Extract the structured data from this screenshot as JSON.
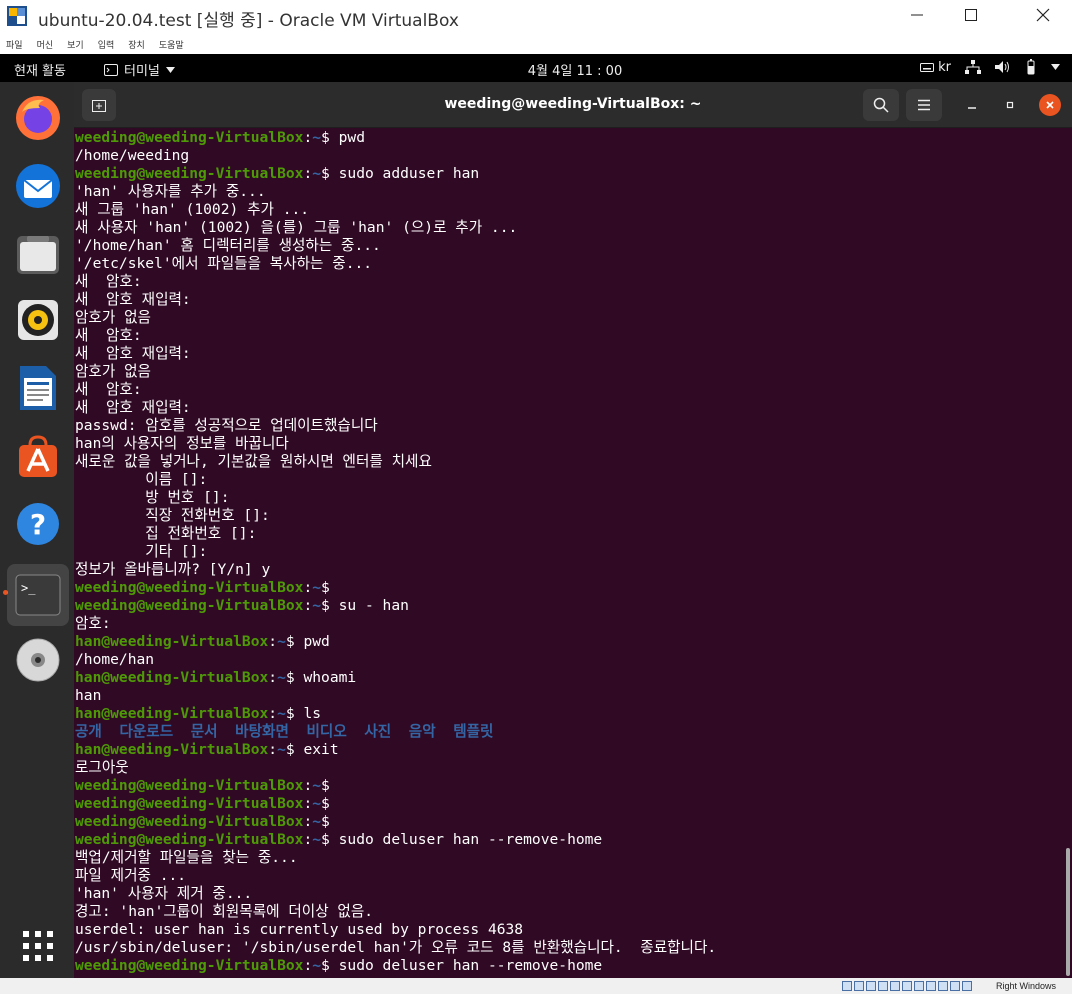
{
  "window": {
    "title": "ubuntu-20.04.test [실행 중] - Oracle VM VirtualBox"
  },
  "vbox_menu": [
    "파일",
    "머신",
    "보기",
    "입력",
    "장치",
    "도움말"
  ],
  "topbar": {
    "activities": "현재 활동",
    "app_name": "터미널",
    "clock": "4월 4일  11 : 00",
    "input_method": "kr"
  },
  "terminal": {
    "title": "weeding@weeding-VirtualBox: ~",
    "lines": [
      {
        "user": "weeding@weeding-VirtualBox",
        "path": "~",
        "cmd": "pwd"
      },
      {
        "text": "/home/weeding"
      },
      {
        "user": "weeding@weeding-VirtualBox",
        "path": "~",
        "cmd": "sudo adduser han"
      },
      {
        "text": "'han' 사용자를 추가 중..."
      },
      {
        "text": "새 그룹 'han' (1002) 추가 ..."
      },
      {
        "text": "새 사용자 'han' (1002) 을(를) 그룹 'han' (으)로 추가 ..."
      },
      {
        "text": "'/home/han' 홈 디렉터리를 생성하는 중..."
      },
      {
        "text": "'/etc/skel'에서 파일들을 복사하는 중..."
      },
      {
        "text": "새  암호:"
      },
      {
        "text": "새  암호 재입력:"
      },
      {
        "text": "암호가 없음"
      },
      {
        "text": "새  암호:"
      },
      {
        "text": "새  암호 재입력:"
      },
      {
        "text": "암호가 없음"
      },
      {
        "text": "새  암호:"
      },
      {
        "text": "새  암호 재입력:"
      },
      {
        "text": "passwd: 암호를 성공적으로 업데이트했습니다"
      },
      {
        "text": "han의 사용자의 정보를 바꿉니다"
      },
      {
        "text": "새로운 값을 넣거나, 기본값을 원하시면 엔터를 치세요"
      },
      {
        "text": "        이름 []:"
      },
      {
        "text": "        방 번호 []:"
      },
      {
        "text": "        직장 전화번호 []:"
      },
      {
        "text": "        집 전화번호 []:"
      },
      {
        "text": "        기타 []:"
      },
      {
        "text": "정보가 올바릅니까? [Y/n] y"
      },
      {
        "user": "weeding@weeding-VirtualBox",
        "path": "~",
        "cmd": ""
      },
      {
        "user": "weeding@weeding-VirtualBox",
        "path": "~",
        "cmd": "su - han"
      },
      {
        "text": "암호:"
      },
      {
        "user": "han@weeding-VirtualBox",
        "path": "~",
        "cmd": "pwd"
      },
      {
        "text": "/home/han"
      },
      {
        "user": "han@weeding-VirtualBox",
        "path": "~",
        "cmd": "whoami"
      },
      {
        "text": "han"
      },
      {
        "user": "han@weeding-VirtualBox",
        "path": "~",
        "cmd": "ls"
      },
      {
        "dirs": [
          "공개",
          "다운로드",
          "문서",
          "바탕화면",
          "비디오",
          "사진",
          "음악",
          "템플릿"
        ]
      },
      {
        "user": "han@weeding-VirtualBox",
        "path": "~",
        "cmd": "exit"
      },
      {
        "text": "로그아웃"
      },
      {
        "user": "weeding@weeding-VirtualBox",
        "path": "~",
        "cmd": ""
      },
      {
        "user": "weeding@weeding-VirtualBox",
        "path": "~",
        "cmd": ""
      },
      {
        "user": "weeding@weeding-VirtualBox",
        "path": "~",
        "cmd": ""
      },
      {
        "user": "weeding@weeding-VirtualBox",
        "path": "~",
        "cmd": "sudo deluser han --remove-home"
      },
      {
        "text": "백업/제거할 파일들을 찾는 중..."
      },
      {
        "text": "파일 제거중 ..."
      },
      {
        "text": "'han' 사용자 제거 중..."
      },
      {
        "text": "경고: 'han'그룹이 회원목록에 더이상 없음."
      },
      {
        "text": "userdel: user han is currently used by process 4638"
      },
      {
        "text": "/usr/sbin/deluser: '/sbin/userdel han'가 오류 코드 8를 반환했습니다.  종료합니다."
      },
      {
        "user": "weeding@weeding-VirtualBox",
        "path": "~",
        "cmd": "sudo deluser han --remove-home"
      }
    ]
  },
  "dock": [
    "firefox-icon",
    "thunderbird-icon",
    "files-icon",
    "rhythmbox-icon",
    "libreoffice-writer-icon",
    "software-center-icon",
    "help-icon",
    "terminal-icon",
    "dvd-icon",
    "show-apps-icon"
  ],
  "status": {
    "host_key": "Right Windows"
  },
  "colors": {
    "terminal_bg": "#300a24",
    "prompt_user": "#4e9a06",
    "prompt_path": "#3465a4",
    "accent": "#e95420"
  }
}
